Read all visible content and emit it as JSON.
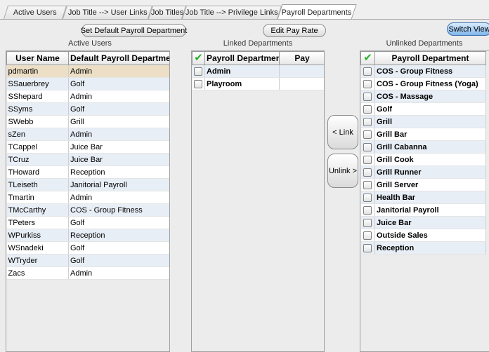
{
  "tabs": [
    {
      "label": "Active Users",
      "active": false
    },
    {
      "label": "Job Title --> User Links",
      "active": false
    },
    {
      "label": "Job Titles",
      "active": false
    },
    {
      "label": "Job Title --> Privilege Links",
      "active": false
    },
    {
      "label": "Payroll Departments",
      "active": true
    }
  ],
  "toolbar": {
    "set_default_label": "Set Default Payroll Department",
    "edit_pay_rate_label": "Edit Pay Rate",
    "switch_view_label": "Switch View"
  },
  "captions": {
    "active_users": "Active Users",
    "linked": "Linked Departments",
    "unlinked": "Unlinked Departments"
  },
  "active_users": {
    "headers": [
      "User Name",
      "Default Payroll Department"
    ],
    "rows": [
      [
        "pdmartin",
        "Admin"
      ],
      [
        "SSauerbrey",
        "Golf"
      ],
      [
        "SShepard",
        "Admin"
      ],
      [
        "SSyms",
        "Golf"
      ],
      [
        "SWebb",
        "Grill"
      ],
      [
        "sZen",
        "Admin"
      ],
      [
        "TCappel",
        "Juice Bar"
      ],
      [
        "TCruz",
        "Juice Bar"
      ],
      [
        "THoward",
        "Reception"
      ],
      [
        "TLeiseth",
        "Janitorial Payroll"
      ],
      [
        "Tmartin",
        "Admin"
      ],
      [
        "TMcCarthy",
        "COS - Group Fitness"
      ],
      [
        "TPeters",
        "Golf"
      ],
      [
        "WPurkiss",
        "Reception"
      ],
      [
        "WSnadeki",
        "Golf"
      ],
      [
        "WTryder",
        "Golf"
      ],
      [
        "Zacs",
        "Admin"
      ]
    ],
    "selected_index": 0
  },
  "linked": {
    "headers": [
      "Payroll Department",
      "Pay"
    ],
    "rows": [
      {
        "name": "Admin",
        "pay": ""
      },
      {
        "name": "Playroom",
        "pay": ""
      }
    ]
  },
  "link_buttons": {
    "link": "< Link",
    "unlink": "Unlink >"
  },
  "unlinked": {
    "headers": [
      "Payroll Department"
    ],
    "rows": [
      "COS - Group Fitness",
      "COS - Group Fitness (Yoga)",
      "COS - Massage",
      "Golf",
      "Grill",
      "Grill Bar",
      "Grill Cabanna",
      "Grill Cook",
      "Grill Runner",
      "Grill Server",
      "Health Bar",
      "Janitorial Payroll",
      "Juice Bar",
      "Outside Sales",
      "Reception"
    ]
  }
}
